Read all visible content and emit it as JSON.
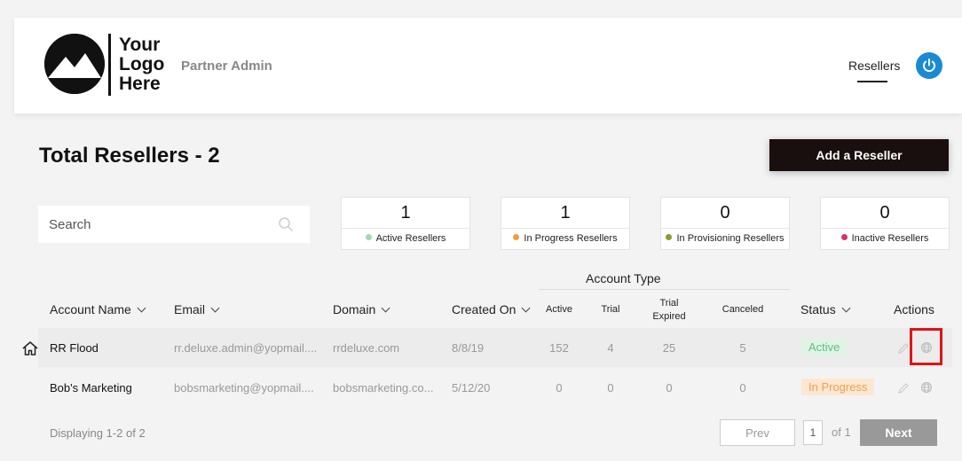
{
  "header": {
    "logo_lines": [
      "Your",
      "Logo",
      "Here"
    ],
    "partner_label": "Partner Admin",
    "nav_resellers": "Resellers",
    "power_icon": "power-icon",
    "accent_color": "#1a8ad4"
  },
  "page": {
    "title": "Total Resellers - 2",
    "add_button": "Add a Reseller"
  },
  "search": {
    "placeholder": "Search"
  },
  "stats": [
    {
      "count": "1",
      "label": "Active Resellers",
      "color": "#5cbf7e"
    },
    {
      "count": "1",
      "label": "In Progress Resellers",
      "color": "#f39c3c"
    },
    {
      "count": "0",
      "label": "In Provisioning Resellers",
      "color": "#8b9f2a"
    },
    {
      "count": "0",
      "label": "Inactive Resellers",
      "color": "#d6336c"
    }
  ],
  "table": {
    "account_type_title": "Account Type",
    "headers": {
      "account_name": "Account Name",
      "email": "Email",
      "domain": "Domain",
      "created_on": "Created On",
      "active": "Active",
      "trial": "Trial",
      "trial_expired_1": "Trial",
      "trial_expired_2": "Expired",
      "canceled": "Canceled",
      "status": "Status",
      "actions": "Actions"
    },
    "rows": [
      {
        "name": "RR Flood",
        "email": "rr.deluxe.admin@yopmail....",
        "domain": "rrdeluxe.com",
        "created": "8/8/19",
        "active": "152",
        "trial": "4",
        "trial_expired": "25",
        "canceled": "5",
        "status": "Active"
      },
      {
        "name": "Bob's Marketing",
        "email": "bobsmarketing@yopmail....",
        "domain": "bobsmarketing.co...",
        "created": "5/12/20",
        "active": "0",
        "trial": "0",
        "trial_expired": "0",
        "canceled": "0",
        "status": "In Progress"
      }
    ]
  },
  "pagination": {
    "displaying": "Displaying 1-2 of 2",
    "prev": "Prev",
    "page": "1",
    "of": "of 1",
    "next": "Next"
  }
}
